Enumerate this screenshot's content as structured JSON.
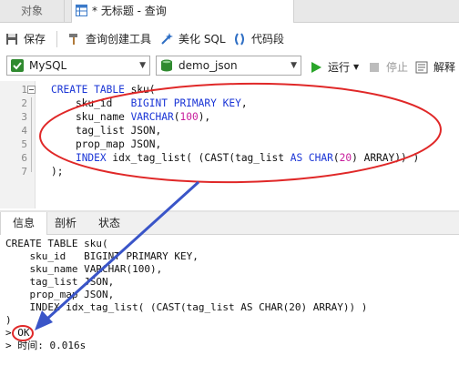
{
  "tabs": {
    "objects_label": "对象",
    "query_label": "* 无标题 - 查询"
  },
  "toolbar": {
    "save_label": "保存",
    "query_builder_label": "查询创建工具",
    "beautify_label": "美化 SQL",
    "code_snippet_label": "代码段"
  },
  "selectors": {
    "connection": "MySQL",
    "database": "demo_json"
  },
  "run_controls": {
    "run_label": "运行",
    "stop_label": "停止",
    "explain_label": "解释"
  },
  "editor": {
    "line_numbers": [
      "1",
      "2",
      "3",
      "4",
      "5",
      "6",
      "7"
    ],
    "lines": [
      [
        {
          "t": "CREATE TABLE",
          "c": "kw"
        },
        {
          "t": " sku(",
          "c": "txt"
        }
      ],
      [
        {
          "t": "    sku_id   ",
          "c": "txt"
        },
        {
          "t": "BIGINT PRIMARY KEY",
          "c": "kw"
        },
        {
          "t": ",",
          "c": "txt"
        }
      ],
      [
        {
          "t": "    sku_name ",
          "c": "txt"
        },
        {
          "t": "VARCHAR",
          "c": "kw"
        },
        {
          "t": "(",
          "c": "txt"
        },
        {
          "t": "100",
          "c": "num"
        },
        {
          "t": "),",
          "c": "txt"
        }
      ],
      [
        {
          "t": "    tag_list JSON,",
          "c": "txt"
        }
      ],
      [
        {
          "t": "    prop_map JSON,",
          "c": "txt"
        }
      ],
      [
        {
          "t": "    ",
          "c": "txt"
        },
        {
          "t": "INDEX",
          "c": "kw"
        },
        {
          "t": " idx_tag_list( (CAST(tag_list ",
          "c": "txt"
        },
        {
          "t": "AS CHAR",
          "c": "kw"
        },
        {
          "t": "(",
          "c": "txt"
        },
        {
          "t": "20",
          "c": "num"
        },
        {
          "t": ") ARRAY)) )",
          "c": "txt"
        }
      ],
      [
        {
          "t": ");",
          "c": "txt"
        }
      ]
    ]
  },
  "result_tabs": [
    "信息",
    "剖析",
    "状态"
  ],
  "output": {
    "lines": [
      "CREATE TABLE sku(",
      "    sku_id   BIGINT PRIMARY KEY,",
      "    sku_name VARCHAR(100),",
      "    tag_list JSON,",
      "    prop_map JSON,",
      "    INDEX idx_tag_list( (CAST(tag_list AS CHAR(20) ARRAY)) )",
      ")",
      "> OK",
      "> 时间: 0.016s"
    ]
  },
  "colors": {
    "keyword": "#1a35d6",
    "number": "#c81e9c",
    "annotation_red": "#e02828",
    "annotation_arrow": "#3a55c8",
    "run_green": "#2aa52a"
  }
}
